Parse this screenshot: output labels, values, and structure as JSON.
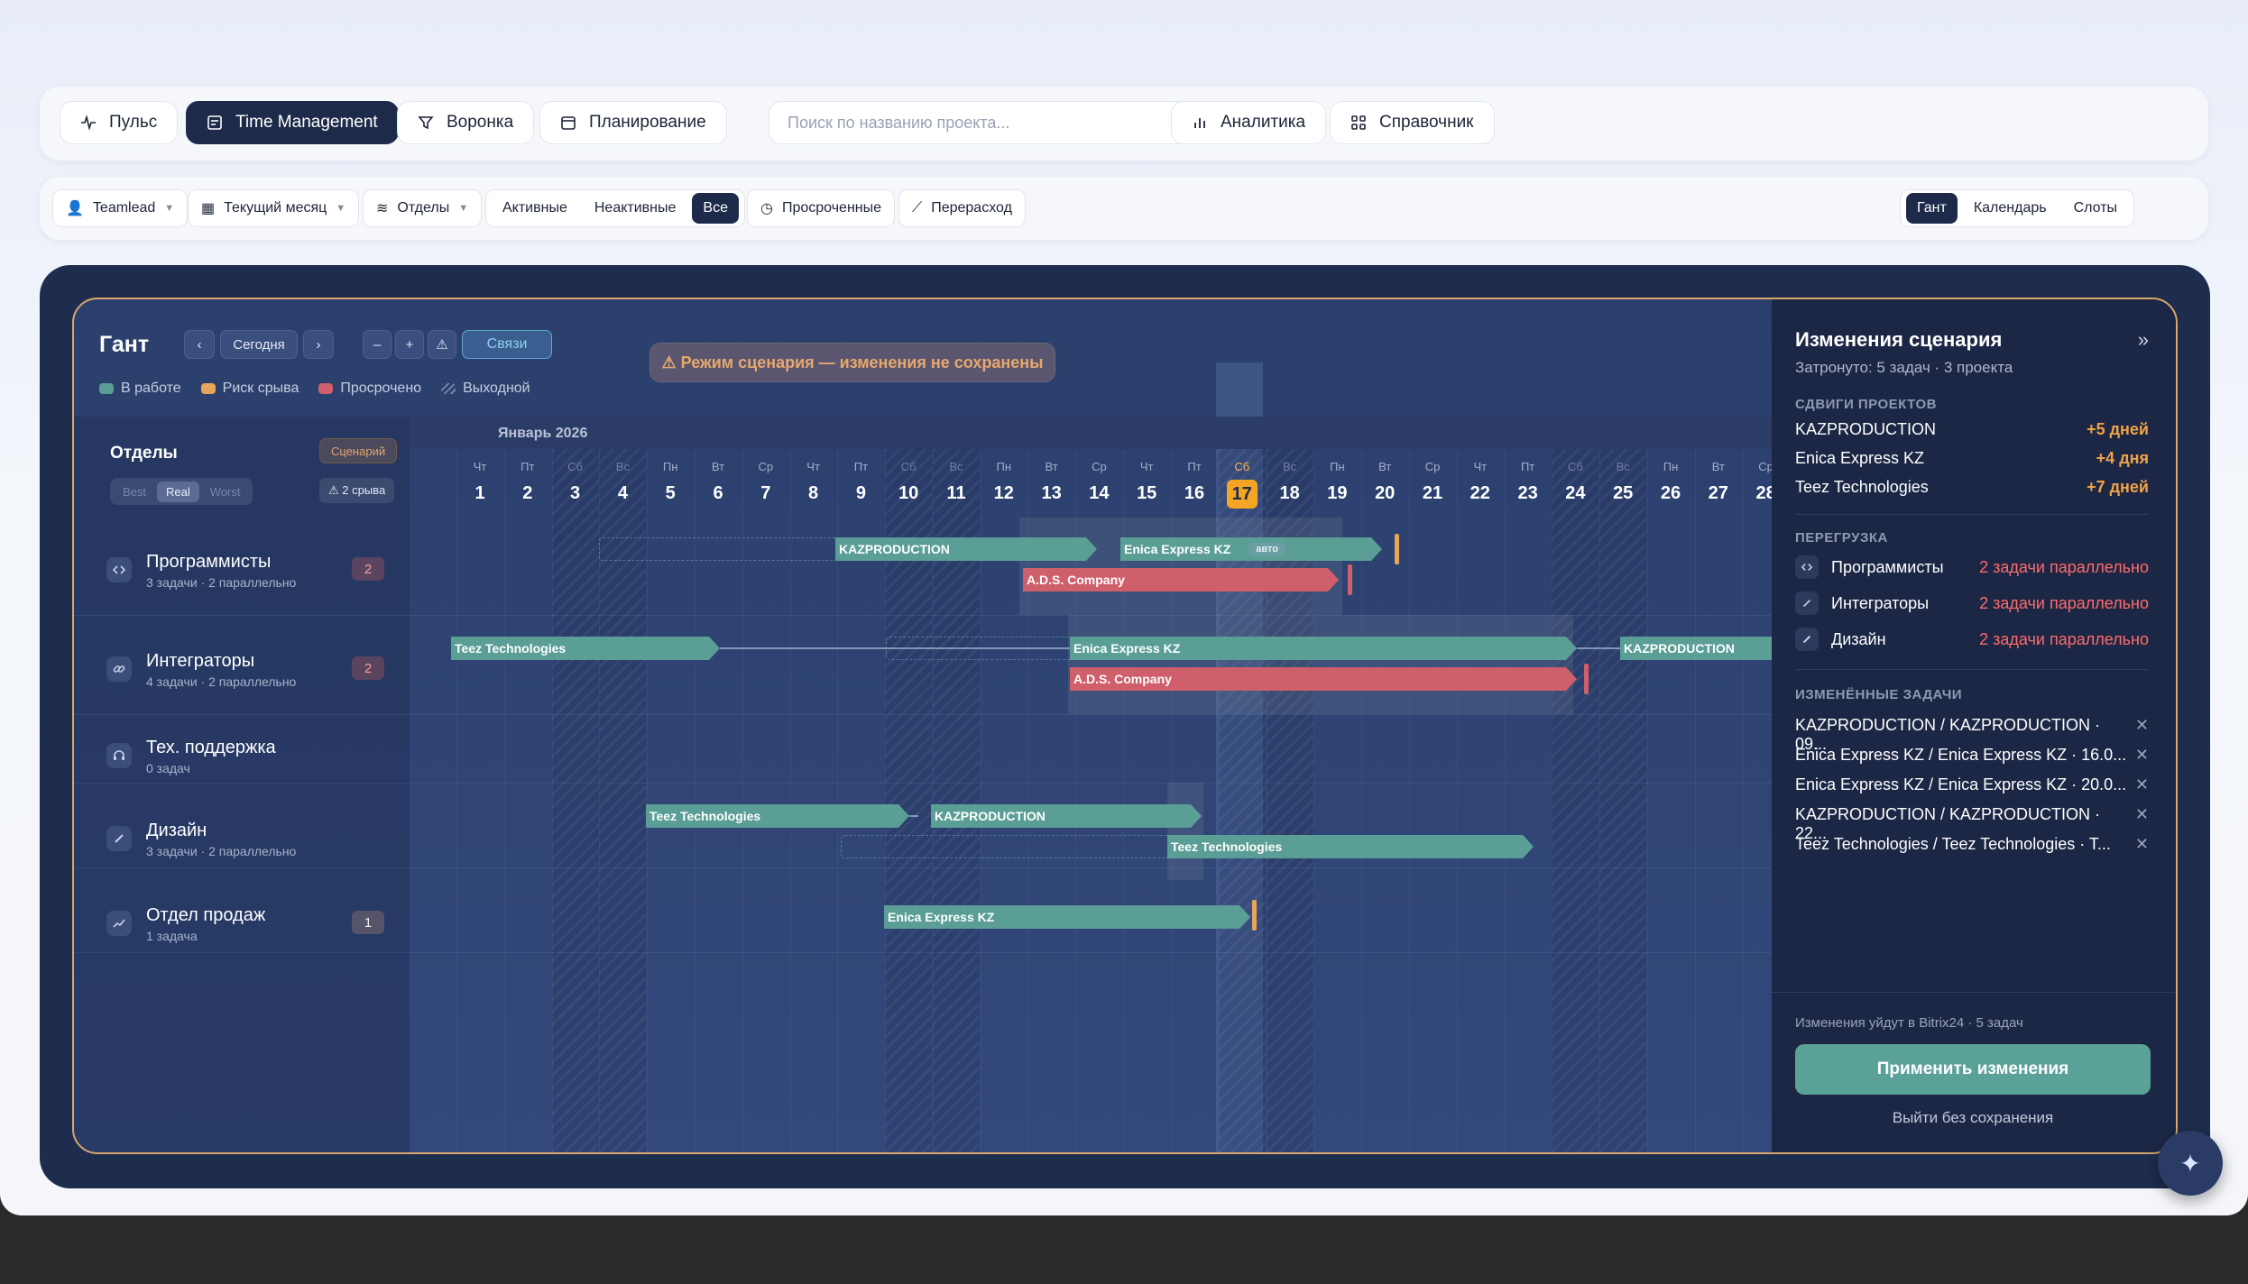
{
  "topnav": {
    "pulse": "Пульс",
    "time_management": "Time Management",
    "funnel": "Воронка",
    "planning": "Планирование",
    "search_placeholder": "Поиск по названию проекта...",
    "analytics": "Аналитика",
    "reference": "Справочник"
  },
  "filters": {
    "teamlead": "Teamlead",
    "period": "Текущий месяц",
    "departments": "Отделы",
    "status": [
      "Активные",
      "Неактивные",
      "Все"
    ],
    "overdue": "Просроченные",
    "overspend": "Перерасход",
    "views": [
      "Гант",
      "Календарь",
      "Слоты"
    ]
  },
  "gantt": {
    "title": "Гант",
    "prev": "‹",
    "today": "Сегодня",
    "next": "›",
    "zoom_out": "–",
    "zoom_in": "+",
    "links": "Связи",
    "legend": [
      "В работе",
      "Риск срыва",
      "Просрочено",
      "Выходной"
    ],
    "scenario_warning": "⚠ Режим сценария — изменения не сохранены",
    "departments_header": "Отделы",
    "scenario_badge": "Сценарий",
    "scenario_modes": [
      "Best",
      "Real",
      "Worst"
    ],
    "slips_badge": "⚠ 2 срыва",
    "month": "Январь 2026",
    "days": [
      {
        "n": "1",
        "w": "Чт"
      },
      {
        "n": "2",
        "w": "Пт"
      },
      {
        "n": "3",
        "w": "Сб"
      },
      {
        "n": "4",
        "w": "Вс"
      },
      {
        "n": "5",
        "w": "Пн"
      },
      {
        "n": "6",
        "w": "Вт"
      },
      {
        "n": "7",
        "w": "Ср"
      },
      {
        "n": "8",
        "w": "Чт"
      },
      {
        "n": "9",
        "w": "Пт"
      },
      {
        "n": "10",
        "w": "Сб"
      },
      {
        "n": "11",
        "w": "Вс"
      },
      {
        "n": "12",
        "w": "Пн"
      },
      {
        "n": "13",
        "w": "Вт"
      },
      {
        "n": "14",
        "w": "Ср"
      },
      {
        "n": "15",
        "w": "Чт"
      },
      {
        "n": "16",
        "w": "Пт"
      },
      {
        "n": "17",
        "w": "Сб"
      },
      {
        "n": "18",
        "w": "Вс"
      },
      {
        "n": "19",
        "w": "Пн"
      },
      {
        "n": "20",
        "w": "Вт"
      },
      {
        "n": "21",
        "w": "Ср"
      },
      {
        "n": "22",
        "w": "Чт"
      },
      {
        "n": "23",
        "w": "Пт"
      },
      {
        "n": "24",
        "w": "Сб"
      },
      {
        "n": "25",
        "w": "Вс"
      },
      {
        "n": "26",
        "w": "Пн"
      },
      {
        "n": "27",
        "w": "Вт"
      },
      {
        "n": "28",
        "w": "Ср"
      }
    ],
    "today_day": "17",
    "rows": [
      {
        "name": "Программисты",
        "sub": "3 задачи · 2 параллельно",
        "count": "2"
      },
      {
        "name": "Интеграторы",
        "sub": "4 задачи · 2 параллельно",
        "count": "2"
      },
      {
        "name": "Тех. поддержка",
        "sub": "0 задач",
        "count": ""
      },
      {
        "name": "Дизайн",
        "sub": "3 задачи · 2 параллельно",
        "count": ""
      },
      {
        "name": "Отдел продаж",
        "sub": "1 задача",
        "count": "1"
      }
    ],
    "tasks": [
      {
        "label": "KAZPRODUCTION",
        "color": "green"
      },
      {
        "label": "Enica Express KZ",
        "color": "green",
        "tag": "авто"
      },
      {
        "label": "A.D.S. Company",
        "color": "red"
      },
      {
        "label": "Teez Technologies",
        "color": "green"
      },
      {
        "label": "Enica Express KZ",
        "color": "green"
      },
      {
        "label": "KAZPRODUCTION",
        "color": "green"
      },
      {
        "label": "A.D.S. Company",
        "color": "red"
      },
      {
        "label": "Teez Technologies",
        "color": "green"
      },
      {
        "label": "KAZPRODUCTION",
        "color": "green"
      },
      {
        "label": "Teez Technologies",
        "color": "green"
      },
      {
        "label": "Enica Express KZ",
        "color": "green"
      }
    ]
  },
  "panel": {
    "title": "Изменения сценария",
    "collapse": "»",
    "affected": "Затронуто: 5 задач · 3 проекта",
    "shifts_header": "СДВИГИ ПРОЕКТОВ",
    "shifts": [
      {
        "project": "KAZPRODUCTION",
        "delta": "+5 дней"
      },
      {
        "project": "Enica Express KZ",
        "delta": "+4 дня"
      },
      {
        "project": "Teez Technologies",
        "delta": "+7 дней"
      }
    ],
    "overload_header": "ПЕРЕГРУЗКА",
    "overload": [
      {
        "dept": "Программисты",
        "note": "2 задачи параллельно"
      },
      {
        "dept": "Интеграторы",
        "note": "2 задачи параллельно"
      },
      {
        "dept": "Дизайн",
        "note": "2 задачи параллельно"
      }
    ],
    "changed_header": "ИЗМЕНЁННЫЕ ЗАДАЧИ",
    "changed": [
      "KAZPRODUCTION / KAZPRODUCTION · 09...",
      "Enica Express KZ / Enica Express KZ · 16.0...",
      "Enica Express KZ / Enica Express KZ · 20.0...",
      "KAZPRODUCTION / KAZPRODUCTION · 22...",
      "Teez Technologies / Teez Technologies · T..."
    ],
    "footer_note": "Изменения уйдут в Bitrix24 · 5 задач",
    "apply": "Применить изменения",
    "exit": "Выйти без сохранения"
  },
  "colors": {
    "accent_dark": "#1d2a4a",
    "in_work": "#5a9e96",
    "risk": "#e9a55a",
    "overdue": "#cf5f6a",
    "today": "#f5a524"
  },
  "fab_icon": "sparkle-icon"
}
